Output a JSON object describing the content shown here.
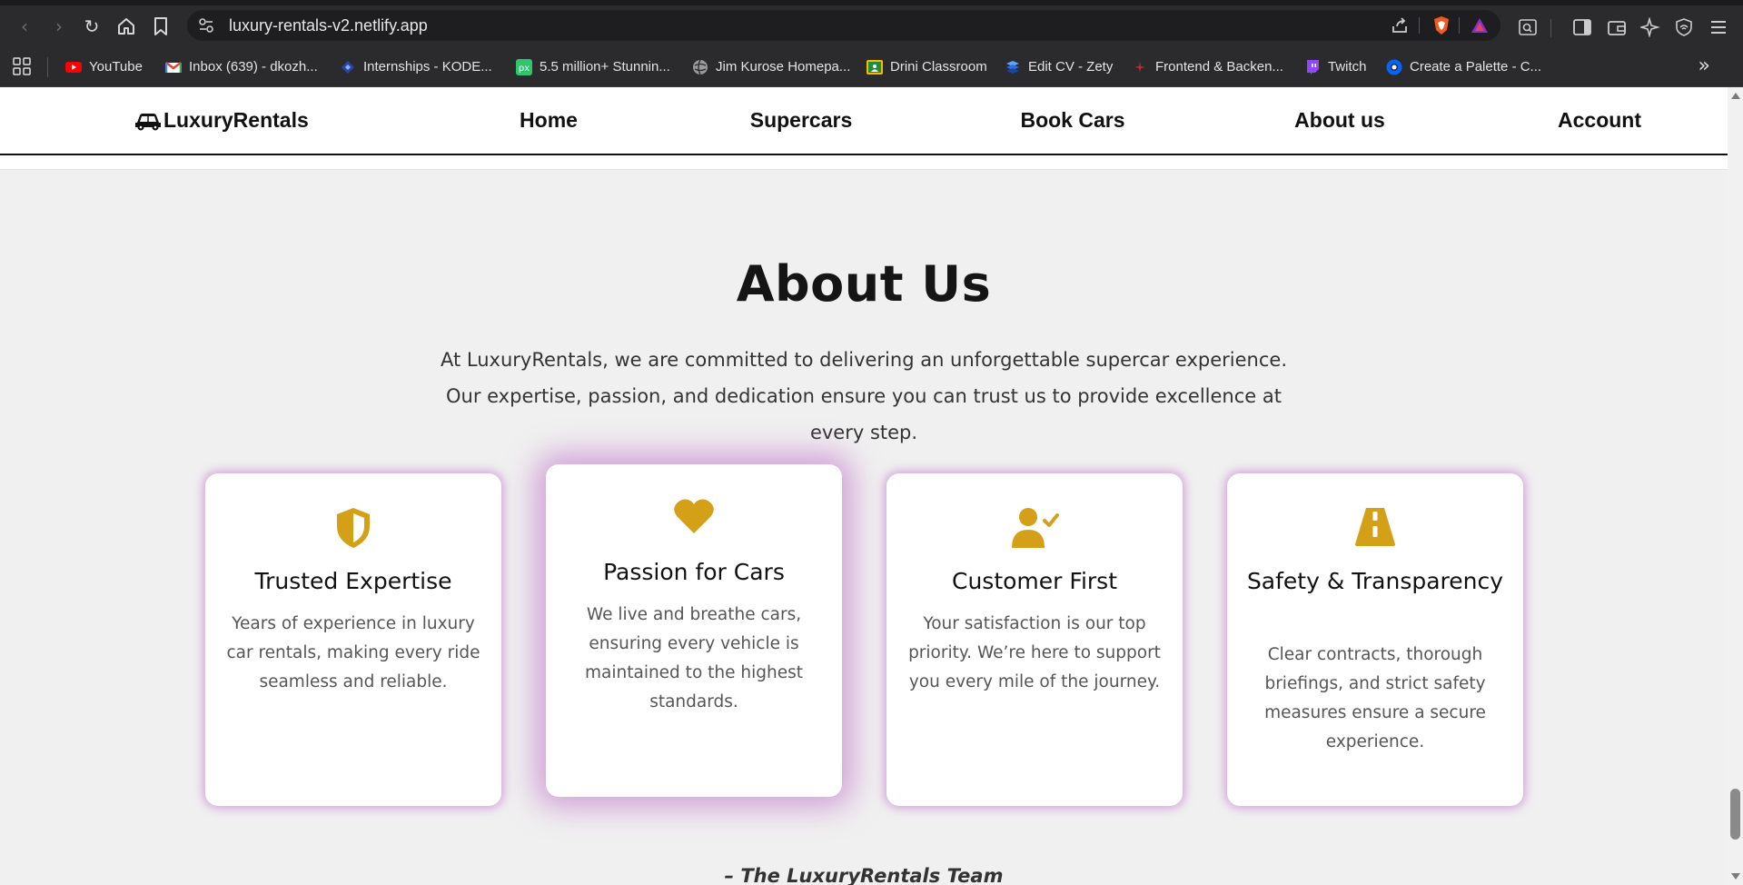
{
  "browser": {
    "url": "luxury-rentals-v2.netlify.app",
    "bookmarks": [
      {
        "label": "YouTube",
        "icon": "youtube-icon"
      },
      {
        "label": "Inbox (639) - dkozh...",
        "icon": "gmail-icon"
      },
      {
        "label": "Internships - KODE...",
        "icon": "kode-icon"
      },
      {
        "label": "5.5 million+ Stunnin...",
        "icon": "pixabay-icon"
      },
      {
        "label": "Jim Kurose Homepa...",
        "icon": "globe-icon"
      },
      {
        "label": "Drini Classroom",
        "icon": "classroom-icon"
      },
      {
        "label": "Edit CV - Zety",
        "icon": "zety-icon"
      },
      {
        "label": "Frontend & Backen...",
        "icon": "sparkle-icon"
      },
      {
        "label": "Twitch",
        "icon": "twitch-icon"
      },
      {
        "label": "Create a Palette - C...",
        "icon": "coolors-icon"
      }
    ],
    "more_bookmarks": "»"
  },
  "site": {
    "brand": "LuxuryRentals",
    "nav": [
      "Home",
      "Supercars",
      "Book Cars",
      "About us",
      "Account"
    ]
  },
  "about": {
    "title": "About Us",
    "intro": "At LuxuryRentals, we are committed to delivering an unforgettable supercar experience. Our expertise, passion, and dedication ensure you can trust us to provide excellence at every step.",
    "cards": [
      {
        "title": "Trusted Expertise",
        "text": "Years of experience in luxury car rentals, making every ride seamless and reliable.",
        "icon": "shield-icon"
      },
      {
        "title": "Passion for Cars",
        "text": "We live and breathe cars, ensuring every vehicle is maintained to the highest standards.",
        "icon": "heart-icon"
      },
      {
        "title": "Customer First",
        "text": "Your satisfaction is our top priority. We’re here to support you every mile of the journey.",
        "icon": "user-check-icon"
      },
      {
        "title": "Safety & Transparency",
        "text": "Clear contracts, thorough briefings, and strict safety measures ensure a secure experience.",
        "icon": "road-icon"
      }
    ],
    "signature": "– The LuxuryRentals Team"
  },
  "colors": {
    "accent_gold": "#D4A017",
    "card_glow": "#C27BCC",
    "page_bg": "#F0F0F0"
  }
}
